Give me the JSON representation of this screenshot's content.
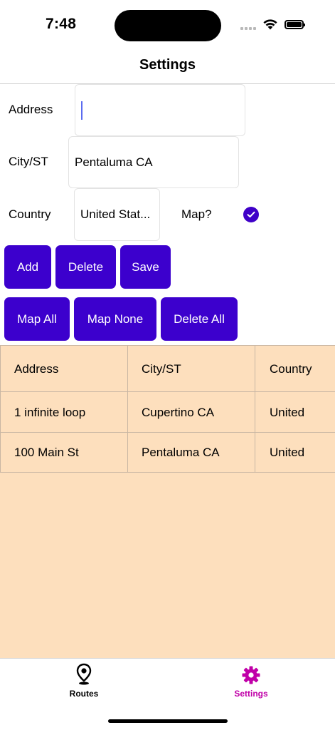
{
  "status_bar": {
    "time": "7:48"
  },
  "nav": {
    "title": "Settings"
  },
  "form": {
    "address_label": "Address",
    "address_value": "",
    "city_label": "City/ST",
    "city_value": "Pentaluma CA",
    "country_label": "Country",
    "country_value": "United Stat...",
    "map_label": "Map?",
    "map_checked": true
  },
  "buttons": {
    "add": "Add",
    "delete": "Delete",
    "save": "Save",
    "map_all": "Map All",
    "map_none": "Map None",
    "delete_all": "Delete All"
  },
  "table": {
    "headers": [
      "Address",
      "City/ST",
      "Country"
    ],
    "rows": [
      [
        "1 infinite loop",
        "Cupertino CA",
        "United"
      ],
      [
        "100 Main St",
        "Pentaluma CA",
        "United"
      ]
    ]
  },
  "tabbar": {
    "items": [
      {
        "label": "Routes",
        "icon": "map-pin-icon",
        "active": false
      },
      {
        "label": "Settings",
        "icon": "gear-icon",
        "active": true
      }
    ],
    "active_color": "#c000a8"
  },
  "colors": {
    "button": "#3c00cd",
    "table_background": "#fddfbd",
    "checkbox": "#3f00c8"
  }
}
